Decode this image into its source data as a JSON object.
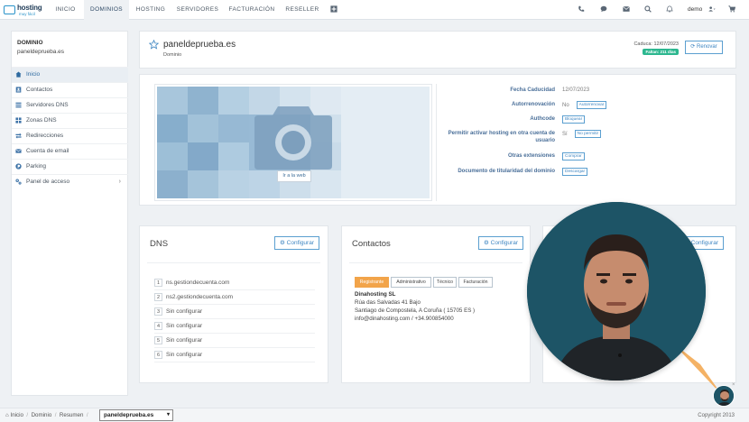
{
  "brand": {
    "line1": "hosting",
    "line2": "muy fácil"
  },
  "nav": {
    "items": [
      "INICIO",
      "DOMINIOS",
      "HOSTING",
      "SERVIDORES",
      "FACTURACIÓN",
      "RESELLER"
    ],
    "active": "DOMINIOS",
    "user": "demo"
  },
  "sidebar": {
    "label": "DOMINIO",
    "domain": "paneldeprueba.es",
    "items": [
      {
        "label": "Inicio",
        "icon": "home-icon"
      },
      {
        "label": "Contactos",
        "icon": "contact-card-icon"
      },
      {
        "label": "Servidores DNS",
        "icon": "dns-server-icon"
      },
      {
        "label": "Zonas DNS",
        "icon": "dns-zone-icon"
      },
      {
        "label": "Redirecciones",
        "icon": "redirect-icon"
      },
      {
        "label": "Cuenta de email",
        "icon": "envelope-icon"
      },
      {
        "label": "Parking",
        "icon": "parking-icon"
      },
      {
        "label": "Panel de acceso",
        "icon": "access-panel-icon"
      }
    ]
  },
  "header": {
    "title": "paneldeprueba.es",
    "subtitle": "Dominio",
    "expiry_label": "Caduca: 12/07/2023",
    "badge": "Faltan: 211 días",
    "renew": "Renovar"
  },
  "preview": {
    "button": "Ir a la web"
  },
  "details": [
    {
      "label": "Fecha Caducidad",
      "value": "12/07/2023",
      "buttons": []
    },
    {
      "label": "Autorrenovación",
      "value": "No",
      "buttons": [
        "Autorrenovar"
      ]
    },
    {
      "label": "Authcode",
      "value": "",
      "buttons": [
        "Bloquear"
      ]
    },
    {
      "label": "Permitir activar hosting en otra cuenta de usuario",
      "value": "Sí",
      "buttons": [
        "No permitir"
      ]
    },
    {
      "label": "Otras extensiones",
      "value": "",
      "buttons": [
        "Comprar"
      ]
    },
    {
      "label": "Documento de titularidad del dominio",
      "value": "",
      "buttons": [
        "Descargar"
      ]
    }
  ],
  "dns": {
    "title": "DNS",
    "configure": "Configurar",
    "entries": [
      {
        "num": "1",
        "value": "ns.gestiondecuenta.com"
      },
      {
        "num": "2",
        "value": "ns2.gestiondecuenta.com"
      },
      {
        "num": "3",
        "value": "Sin configurar"
      },
      {
        "num": "4",
        "value": "Sin configurar"
      },
      {
        "num": "5",
        "value": "Sin configurar"
      },
      {
        "num": "6",
        "value": "Sin configurar"
      }
    ]
  },
  "contacts": {
    "title": "Contactos",
    "configure": "Configurar",
    "tabs": [
      "Registrante",
      "Administrativo",
      "Técnico",
      "Facturación"
    ],
    "active_tab": "Registrante",
    "company": "Dinahosting SL",
    "address": "Rúa das Salvadas 41 Bajo",
    "city": "Santiago de Compostela, A Coruña ( 15705 ES )",
    "contact": "info@dinahosting.com / +34.900854000"
  },
  "third_card": {
    "configure": "Configurar"
  },
  "footer": {
    "breadcrumbs": [
      "Inicio",
      "Dominio",
      "Resumen"
    ],
    "selected_domain": "paneldeprueba.es",
    "copyright": "Copyright 2013"
  },
  "colors": {
    "accent": "#3f86c2",
    "badge": "#2cb78f",
    "active_tab": "#f2a44a",
    "presenter_bg": "#1d5466"
  }
}
